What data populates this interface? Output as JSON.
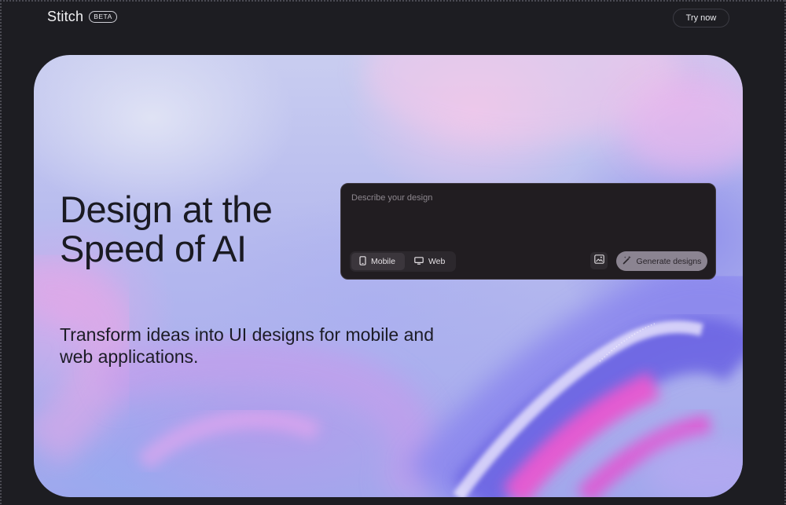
{
  "header": {
    "brand_name": "Stitch",
    "badge": "BETA",
    "cta_label": "Try now"
  },
  "hero": {
    "headline_line1": "Design at the",
    "headline_line2": "Speed of AI",
    "subhead_line1": "Transform ideas into UI designs for mobile and",
    "subhead_line2": "web applications."
  },
  "prompt": {
    "placeholder": "Describe your design",
    "value": "",
    "modes": [
      {
        "label": "Mobile",
        "icon": "mobile-phone-icon",
        "selected": true
      },
      {
        "label": "Web",
        "icon": "monitor-icon",
        "selected": false
      }
    ],
    "image_button_icon": "image-icon",
    "generate_label": "Generate designs",
    "generate_icon": "magic-wand-icon"
  },
  "colors": {
    "page_background": "#1d1d22",
    "prompt_background": "#211d21",
    "generate_button": "#8b8491",
    "hero_accent_pink": "#e95bd0",
    "hero_accent_blue": "#7f7ce8"
  }
}
